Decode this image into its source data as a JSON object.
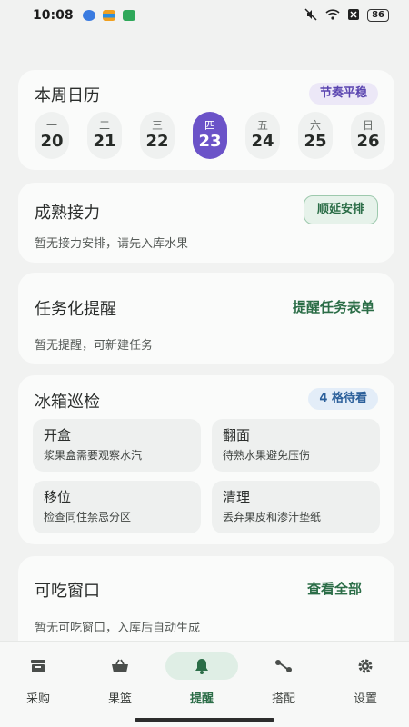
{
  "status_bar": {
    "time": "10:08",
    "battery": "86"
  },
  "week_calendar": {
    "title": "本周日历",
    "badge": "节奏平稳",
    "days": [
      {
        "weekday": "一",
        "date": "20",
        "active": false
      },
      {
        "weekday": "二",
        "date": "21",
        "active": false
      },
      {
        "weekday": "三",
        "date": "22",
        "active": false
      },
      {
        "weekday": "四",
        "date": "23",
        "active": true
      },
      {
        "weekday": "五",
        "date": "24",
        "active": false
      },
      {
        "weekday": "六",
        "date": "25",
        "active": false
      },
      {
        "weekday": "日",
        "date": "26",
        "active": false
      }
    ]
  },
  "ripening_relay": {
    "title": "成熟接力",
    "action": "顺延安排",
    "empty_text": "暂无接力安排，请先入库水果"
  },
  "task_reminder": {
    "title": "任务化提醒",
    "action": "提醒任务表单",
    "empty_text": "暂无提醒，可新建任务"
  },
  "fridge_check": {
    "title": "冰箱巡检",
    "badge": "4 格待看",
    "tiles": [
      {
        "title": "开盒",
        "desc": "浆果盒需要观察水汽"
      },
      {
        "title": "翻面",
        "desc": "待熟水果避免压伤"
      },
      {
        "title": "移位",
        "desc": "检查同住禁忌分区"
      },
      {
        "title": "清理",
        "desc": "丢弃果皮和渗汁垫纸"
      }
    ]
  },
  "eat_window": {
    "title": "可吃窗口",
    "action": "查看全部",
    "empty_text": "暂无可吃窗口，入库后自动生成"
  },
  "bottom_nav": [
    {
      "label": "采购",
      "icon": "archive-box-icon",
      "active": false
    },
    {
      "label": "果篮",
      "icon": "basket-icon",
      "active": false
    },
    {
      "label": "提醒",
      "icon": "bell-icon",
      "active": true
    },
    {
      "label": "搭配",
      "icon": "connect-icon",
      "active": false
    },
    {
      "label": "设置",
      "icon": "gear-icon",
      "active": false
    }
  ],
  "colors": {
    "accent_purple": "#6b53c8",
    "accent_green": "#2b6d47",
    "background": "#f1f2f1"
  }
}
